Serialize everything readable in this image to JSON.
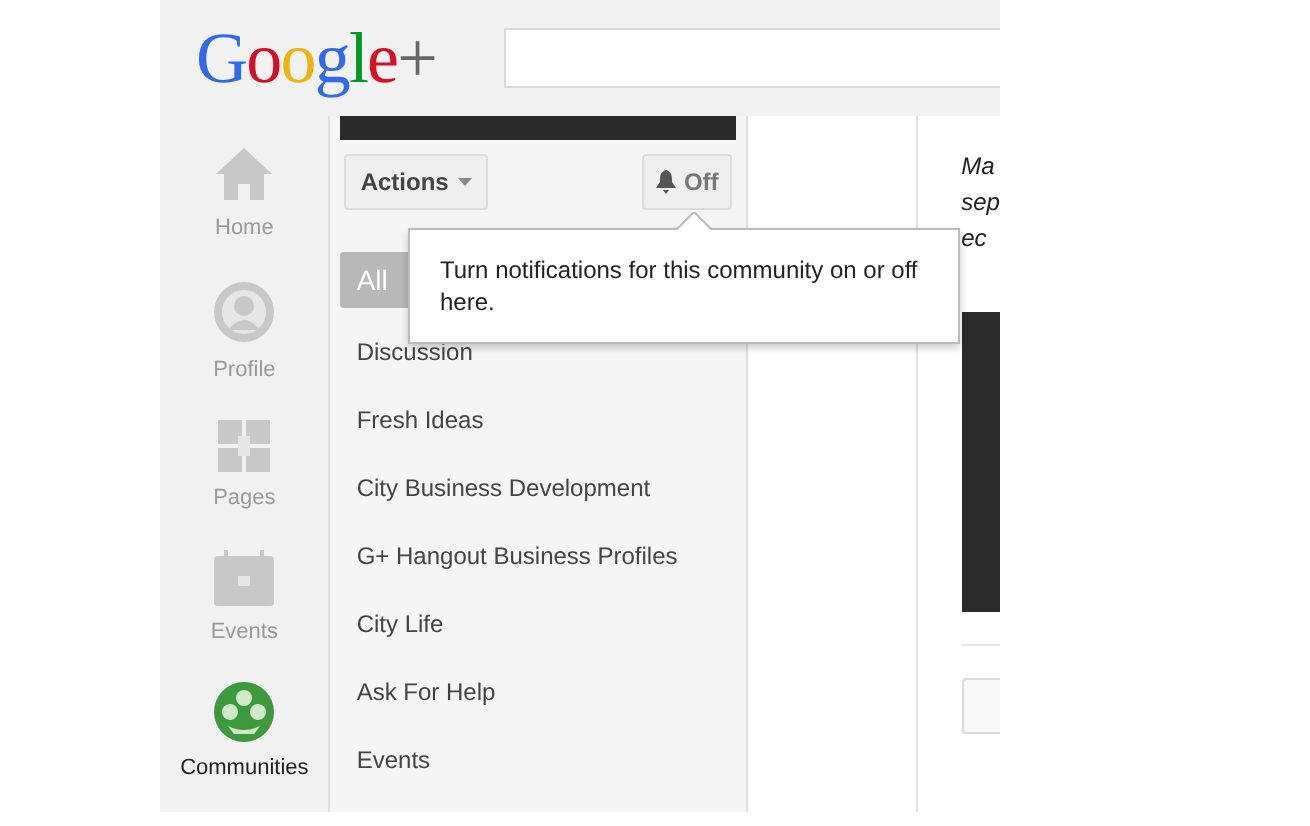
{
  "header": {
    "logo": "Google+"
  },
  "nav": [
    {
      "label": "Home",
      "kind": "home",
      "selected": false
    },
    {
      "label": "Profile",
      "kind": "profile",
      "selected": false
    },
    {
      "label": "Pages",
      "kind": "pages",
      "selected": false
    },
    {
      "label": "Events",
      "kind": "events",
      "selected": false
    },
    {
      "label": "Communities",
      "kind": "communities",
      "selected": true
    }
  ],
  "community": {
    "actions_button": "Actions",
    "notifications_button": {
      "label": "Off",
      "on": false
    },
    "all_posts_chip": "All",
    "categories": [
      "Discussion",
      "Fresh Ideas",
      "City Business Development",
      "G+ Hangout Business Profiles",
      "City Life",
      "Ask For Help",
      "Events"
    ]
  },
  "tooltip": "Turn notifications for this community on or off here.",
  "post_fragment": {
    "lines": [
      "Ma",
      "sep",
      "ec"
    ]
  }
}
